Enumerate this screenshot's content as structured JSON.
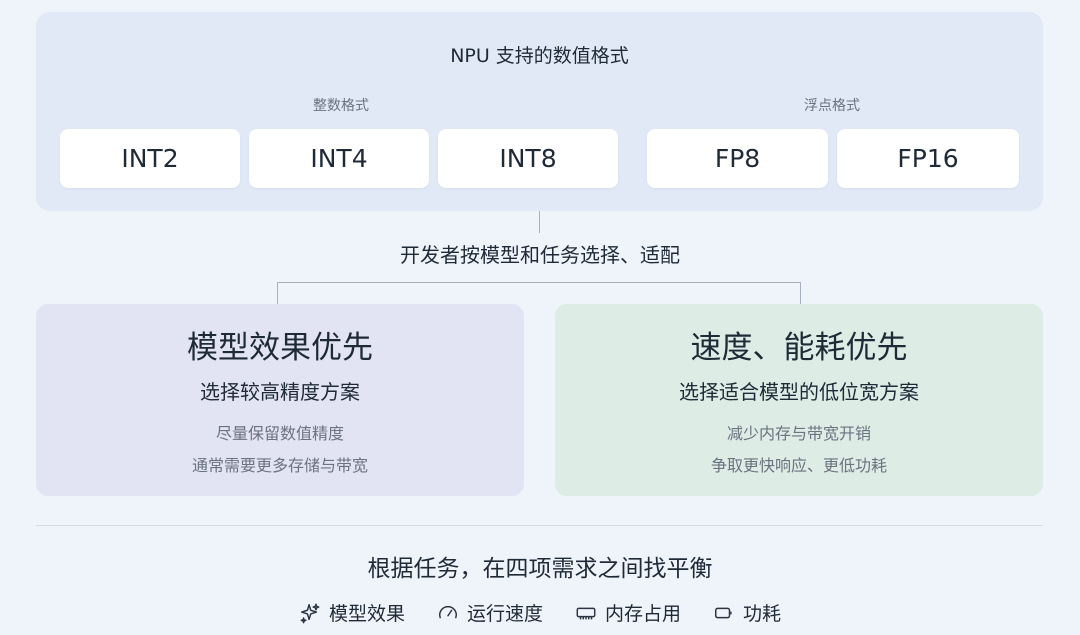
{
  "top": {
    "title": "NPU 支持的数值格式",
    "groups": [
      {
        "label": "整数格式",
        "items": [
          "INT2",
          "INT4",
          "INT8"
        ]
      },
      {
        "label": "浮点格式",
        "items": [
          "FP8",
          "FP16"
        ]
      }
    ]
  },
  "middle_label": "开发者按模型和任务选择、适配",
  "cards": [
    {
      "title": "模型效果优先",
      "subtitle": "选择较高精度方案",
      "lines": [
        "尽量保留数值精度",
        "通常需要更多存储与带宽"
      ],
      "background": "#e3e4f3"
    },
    {
      "title": "速度、能耗优先",
      "subtitle": "选择适合模型的低位宽方案",
      "lines": [
        "减少内存与带宽开销",
        "争取更快响应、更低功耗"
      ],
      "background": "#deece6"
    }
  ],
  "bottom": {
    "title": "根据任务，在四项需求之间找平衡",
    "factors": [
      {
        "label": "模型效果",
        "icon": "sparkle-icon"
      },
      {
        "label": "运行速度",
        "icon": "speedometer-icon"
      },
      {
        "label": "内存占用",
        "icon": "memory-chip-icon"
      },
      {
        "label": "功耗",
        "icon": "battery-icon"
      }
    ]
  }
}
